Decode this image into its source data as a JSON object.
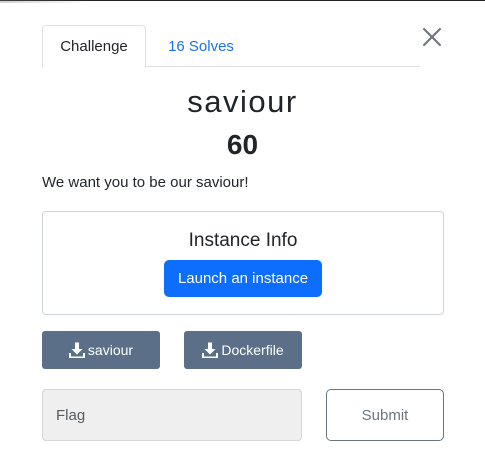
{
  "tabs": {
    "challenge_label": "Challenge",
    "solves_label": "16 Solves"
  },
  "challenge": {
    "name": "saviour",
    "points": "60",
    "description": "We want you to be our saviour!"
  },
  "instance": {
    "title": "Instance Info",
    "launch_label": "Launch an instance"
  },
  "files": [
    {
      "label": "saviour",
      "icon": "download-icon"
    },
    {
      "label": "Dockerfile",
      "icon": "download-icon"
    }
  ],
  "flag": {
    "placeholder": "Flag",
    "value": ""
  },
  "submit_label": "Submit",
  "colors": {
    "primary": "#0d6efd",
    "file_button": "#5b7088",
    "tab_link": "#1a73e8",
    "submit_border": "#6c757d"
  }
}
